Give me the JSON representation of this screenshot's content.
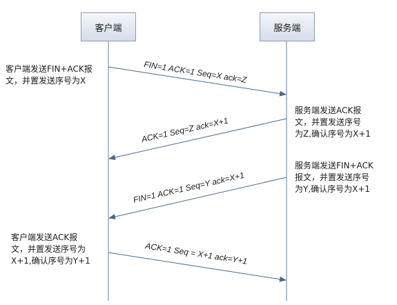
{
  "actors": {
    "client": "客户端",
    "server": "服务端"
  },
  "notes": [
    [
      "客户端发送FIN+ACK报",
      "文，并置发送序号为X"
    ],
    [
      "服务端发送ACK报",
      "文，并置发送序号",
      "为Z,确认序号为X+1"
    ],
    [
      "服务端发送FIN+ACK",
      "报文，并置发送序号",
      "为Y,确认序号为X+1"
    ],
    [
      "客户端发送ACK报",
      "文，并置发送序号为",
      "X+1,确认序号为Y+1"
    ]
  ],
  "messages": [
    "FIN=1 ACK=1  Seq=X  ack=Z",
    "ACK=1 Seq=Z ack=X+1",
    "FIN=1 ACK=1  Seq=Y  ack=X+1",
    "ACK=1 Seq = X+1 ack=Y+1"
  ],
  "colors": {
    "lifeline": "#5f7f9f",
    "arrow": "#4a6b8a",
    "actor_border": "#8a9bb0"
  }
}
